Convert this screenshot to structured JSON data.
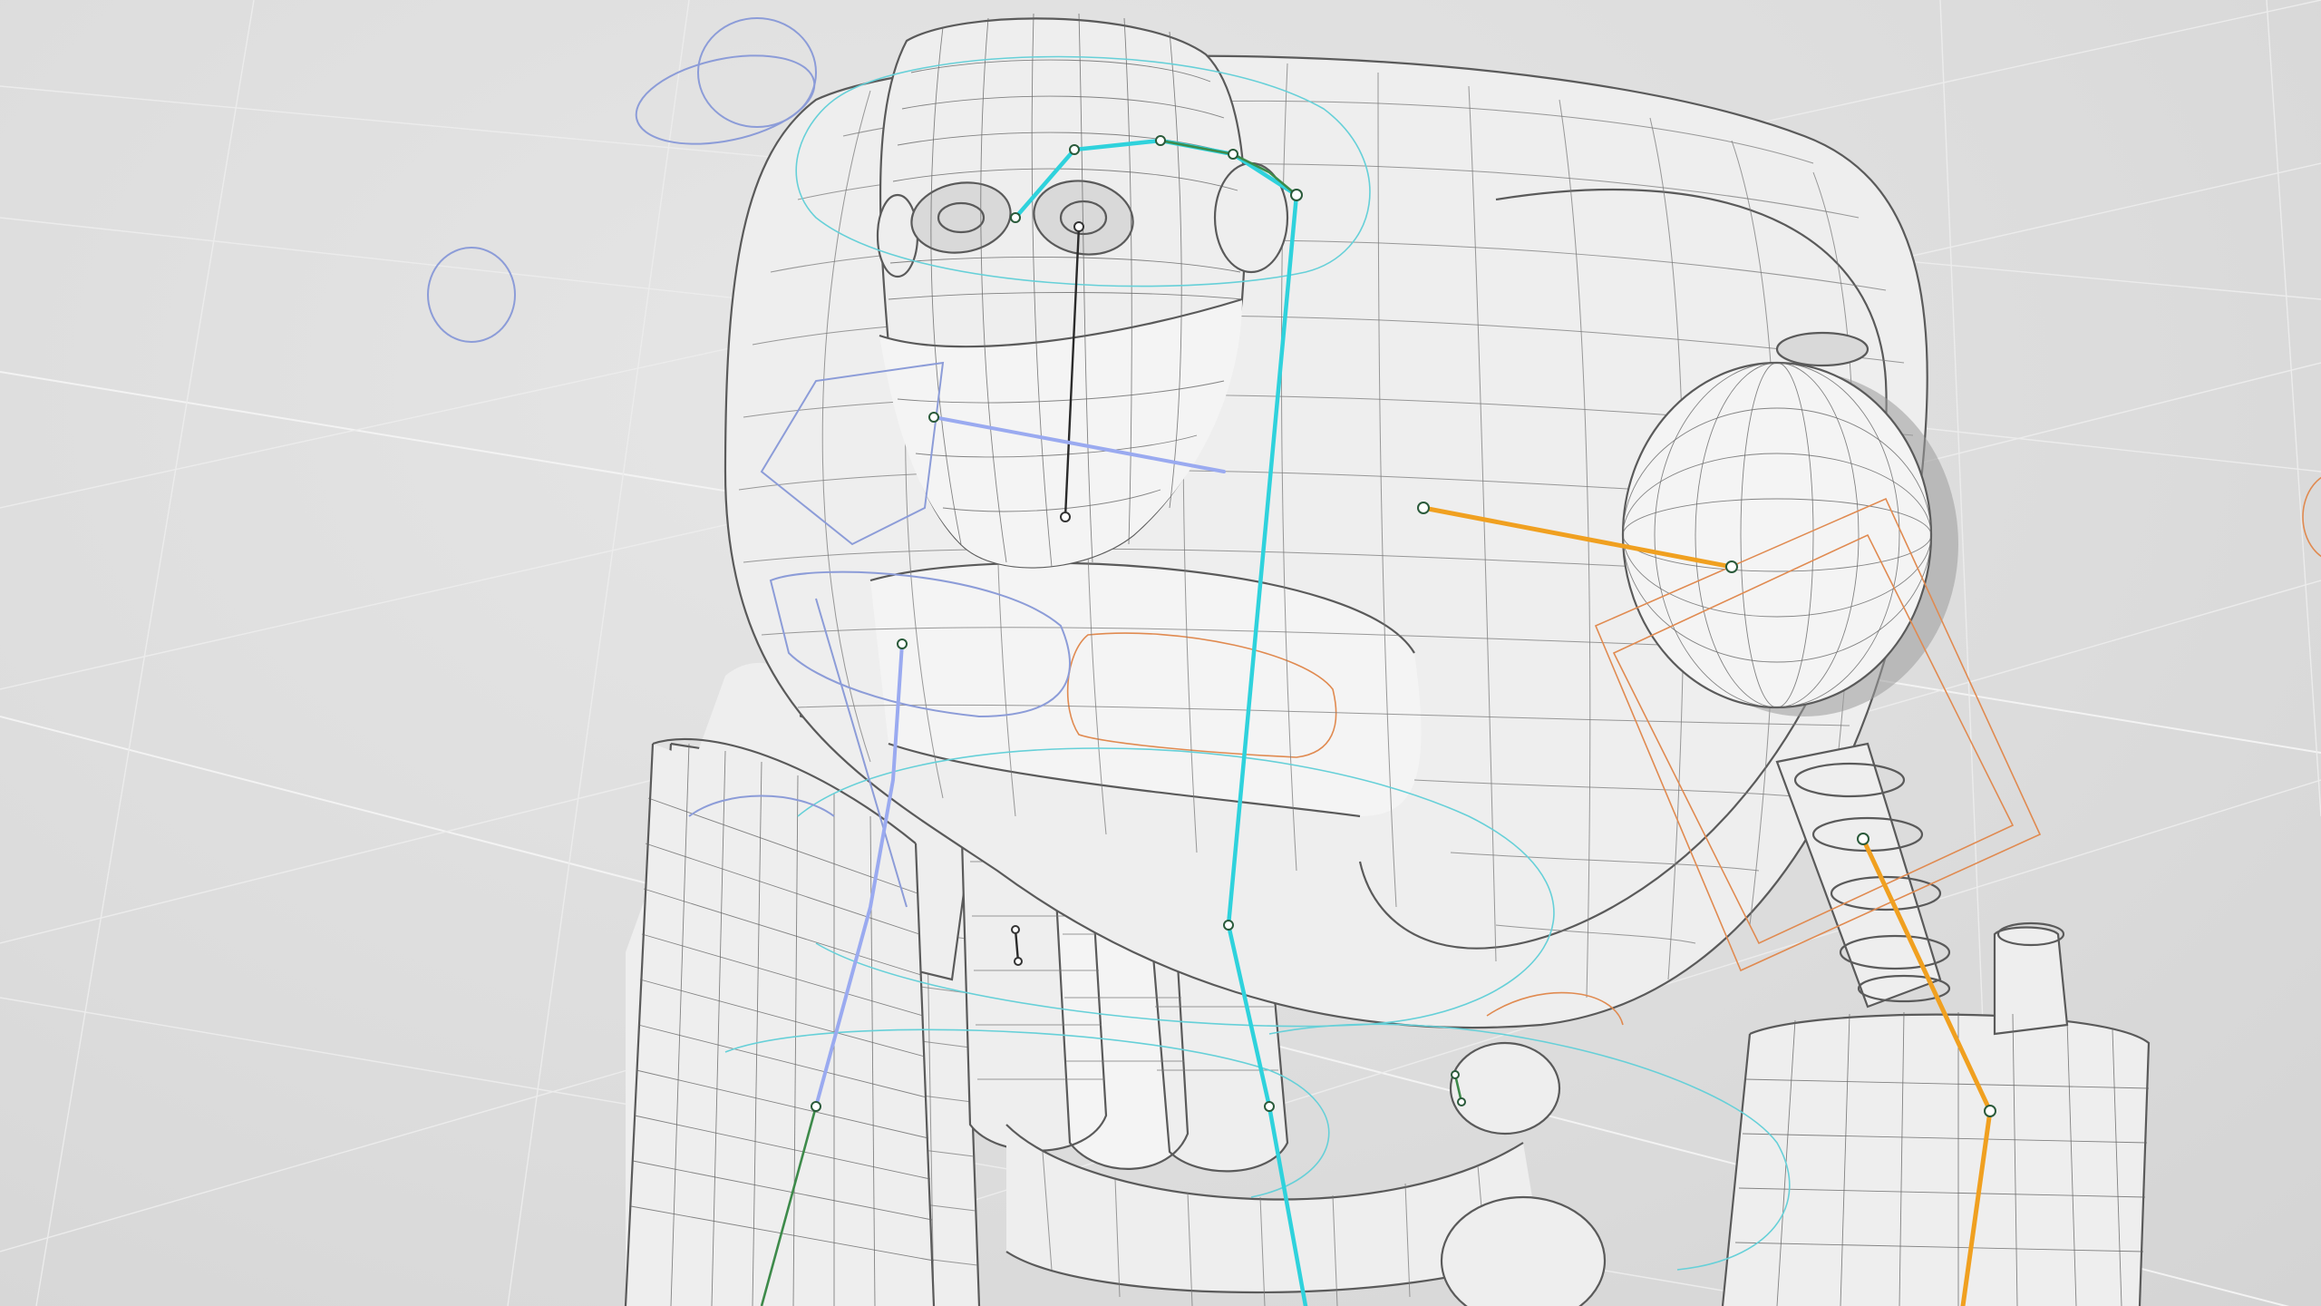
{
  "viewport": {
    "background": "#dedede",
    "mode": "wireframe-on-shaded"
  },
  "scene": {
    "grid_color": "#f3f3f3",
    "mesh_fill": "#eeeeee",
    "wire_color": "#5a5a5a",
    "control_colors": {
      "spine": "#2fd2dc",
      "right_arm": "#f0a020",
      "left_arm": "#9aaaf0",
      "head": "#2a2a2a",
      "orange_control": "#e08a50",
      "blue_control": "#8c9cd8"
    },
    "icons": [
      "robot-character-icon",
      "rig-bone-icon",
      "control-curve-icon"
    ]
  }
}
